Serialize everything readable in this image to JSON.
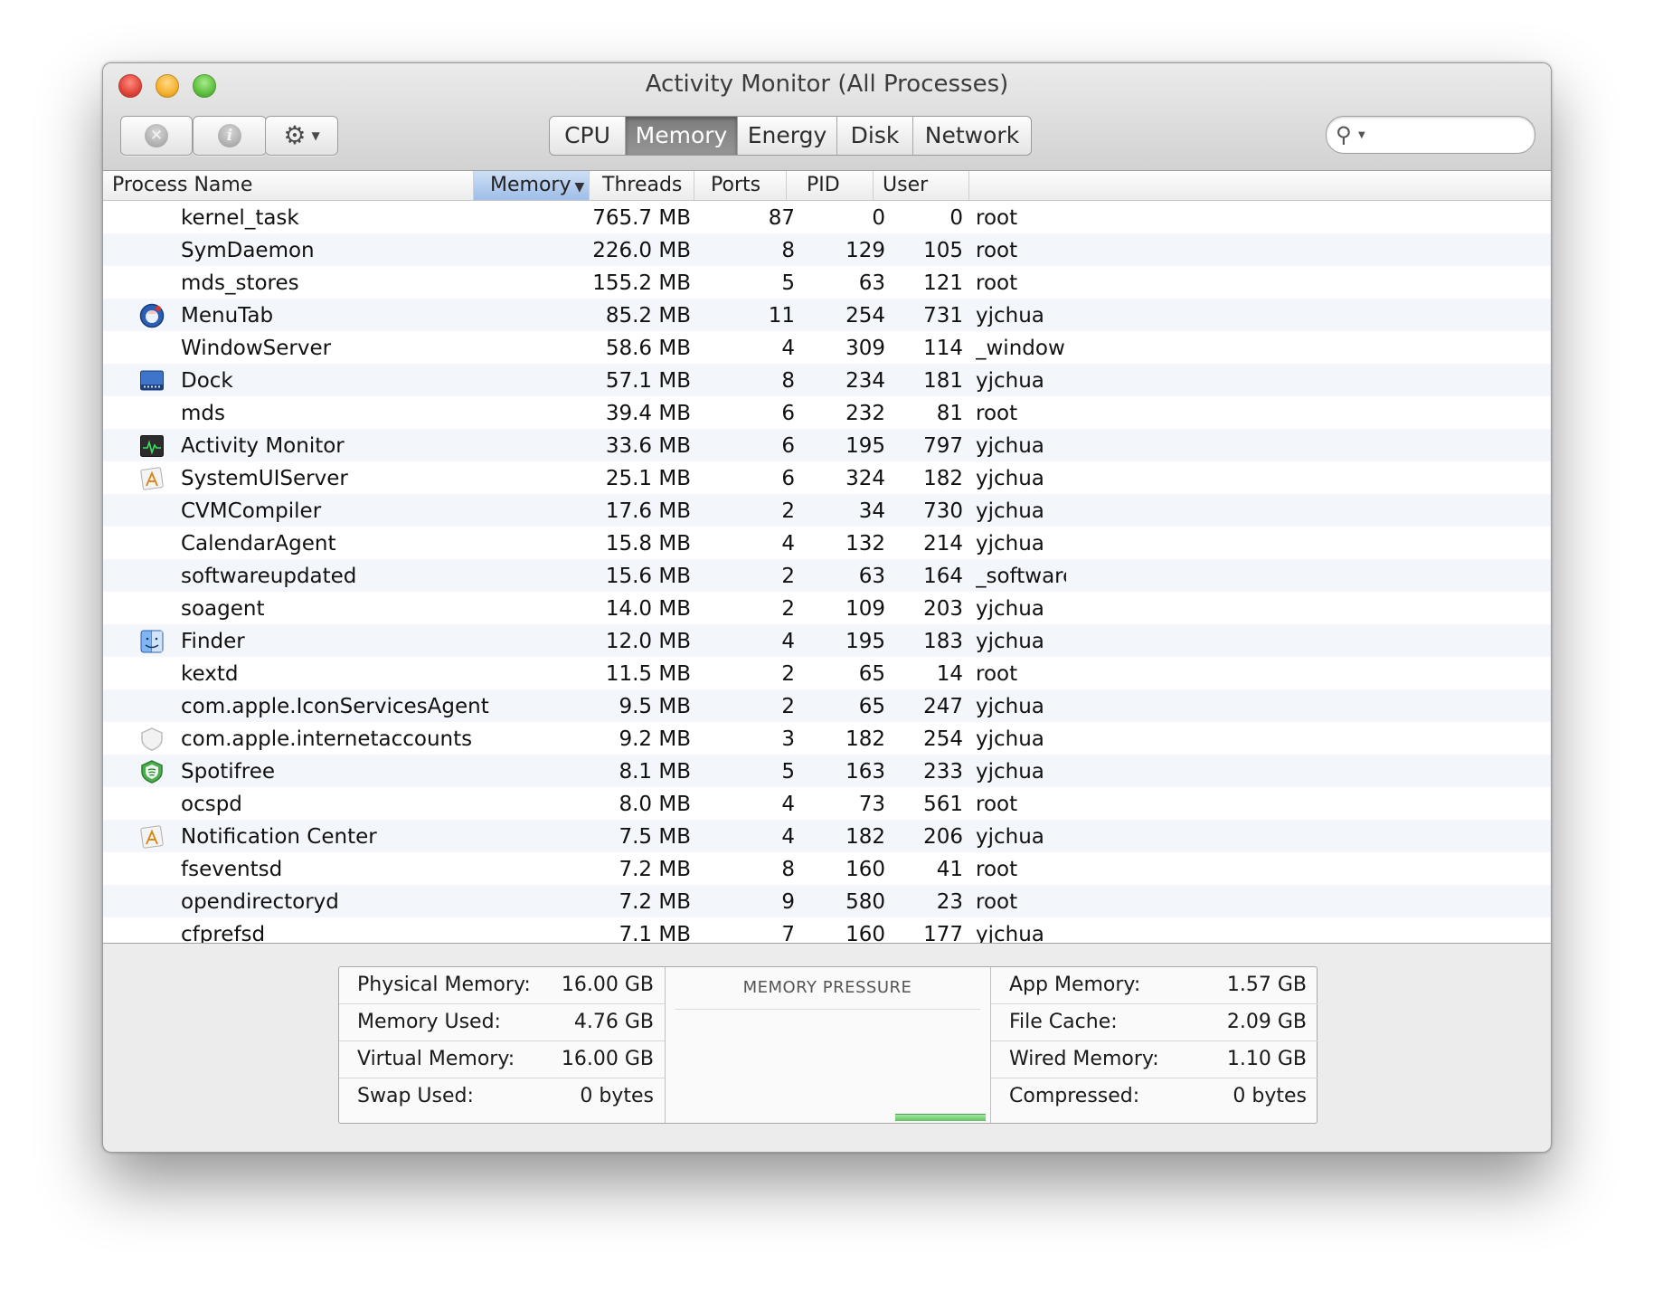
{
  "window": {
    "title": "Activity Monitor (All Processes)"
  },
  "toolbar": {
    "stop_icon": "x-circle-icon",
    "info_icon": "info-circle-icon",
    "gear_icon": "gear-icon",
    "tabs": [
      {
        "label": "CPU",
        "active": false
      },
      {
        "label": "Memory",
        "active": true
      },
      {
        "label": "Energy",
        "active": false
      },
      {
        "label": "Disk",
        "active": false
      },
      {
        "label": "Network",
        "active": false
      }
    ],
    "search": {
      "value": "",
      "placeholder": ""
    }
  },
  "table": {
    "columns": {
      "name": "Process Name",
      "memory": "Memory",
      "threads": "Threads",
      "ports": "Ports",
      "pid": "PID",
      "user": "User"
    },
    "sorted_column": "memory",
    "sort_direction": "descending",
    "rows": [
      {
        "icon": "",
        "name": "kernel_task",
        "memory": "765.7 MB",
        "threads": "87",
        "ports": "0",
        "pid": "0",
        "user": "root"
      },
      {
        "icon": "",
        "name": "SymDaemon",
        "memory": "226.0 MB",
        "threads": "8",
        "ports": "129",
        "pid": "105",
        "user": "root"
      },
      {
        "icon": "",
        "name": "mds_stores",
        "memory": "155.2 MB",
        "threads": "5",
        "ports": "63",
        "pid": "121",
        "user": "root"
      },
      {
        "icon": "menutab",
        "name": "MenuTab",
        "memory": "85.2 MB",
        "threads": "11",
        "ports": "254",
        "pid": "731",
        "user": "yjchua"
      },
      {
        "icon": "",
        "name": "WindowServer",
        "memory": "58.6 MB",
        "threads": "4",
        "ports": "309",
        "pid": "114",
        "user": "_window"
      },
      {
        "icon": "dock",
        "name": "Dock",
        "memory": "57.1 MB",
        "threads": "8",
        "ports": "234",
        "pid": "181",
        "user": "yjchua"
      },
      {
        "icon": "",
        "name": "mds",
        "memory": "39.4 MB",
        "threads": "6",
        "ports": "232",
        "pid": "81",
        "user": "root"
      },
      {
        "icon": "activity-monitor",
        "name": "Activity Monitor",
        "memory": "33.6 MB",
        "threads": "6",
        "ports": "195",
        "pid": "797",
        "user": "yjchua"
      },
      {
        "icon": "generic-app",
        "name": "SystemUIServer",
        "memory": "25.1 MB",
        "threads": "6",
        "ports": "324",
        "pid": "182",
        "user": "yjchua"
      },
      {
        "icon": "",
        "name": "CVMCompiler",
        "memory": "17.6 MB",
        "threads": "2",
        "ports": "34",
        "pid": "730",
        "user": "yjchua"
      },
      {
        "icon": "",
        "name": "CalendarAgent",
        "memory": "15.8 MB",
        "threads": "4",
        "ports": "132",
        "pid": "214",
        "user": "yjchua"
      },
      {
        "icon": "",
        "name": "softwareupdated",
        "memory": "15.6 MB",
        "threads": "2",
        "ports": "63",
        "pid": "164",
        "user": "_software"
      },
      {
        "icon": "",
        "name": "soagent",
        "memory": "14.0 MB",
        "threads": "2",
        "ports": "109",
        "pid": "203",
        "user": "yjchua"
      },
      {
        "icon": "finder",
        "name": "Finder",
        "memory": "12.0 MB",
        "threads": "4",
        "ports": "195",
        "pid": "183",
        "user": "yjchua"
      },
      {
        "icon": "",
        "name": "kextd",
        "memory": "11.5 MB",
        "threads": "2",
        "ports": "65",
        "pid": "14",
        "user": "root"
      },
      {
        "icon": "",
        "name": "com.apple.IconServicesAgent",
        "memory": "9.5 MB",
        "threads": "2",
        "ports": "65",
        "pid": "247",
        "user": "yjchua"
      },
      {
        "icon": "shield-grey",
        "name": "com.apple.internetaccounts",
        "memory": "9.2 MB",
        "threads": "3",
        "ports": "182",
        "pid": "254",
        "user": "yjchua"
      },
      {
        "icon": "shield-green",
        "name": "Spotifree",
        "memory": "8.1 MB",
        "threads": "5",
        "ports": "163",
        "pid": "233",
        "user": "yjchua"
      },
      {
        "icon": "",
        "name": "ocspd",
        "memory": "8.0 MB",
        "threads": "4",
        "ports": "73",
        "pid": "561",
        "user": "root"
      },
      {
        "icon": "generic-app",
        "name": "Notification Center",
        "memory": "7.5 MB",
        "threads": "4",
        "ports": "182",
        "pid": "206",
        "user": "yjchua"
      },
      {
        "icon": "",
        "name": "fseventsd",
        "memory": "7.2 MB",
        "threads": "8",
        "ports": "160",
        "pid": "41",
        "user": "root"
      },
      {
        "icon": "",
        "name": "opendirectoryd",
        "memory": "7.2 MB",
        "threads": "9",
        "ports": "580",
        "pid": "23",
        "user": "root"
      },
      {
        "icon": "",
        "name": "cfprefsd",
        "memory": "7.1 MB",
        "threads": "7",
        "ports": "160",
        "pid": "177",
        "user": "yjchua"
      }
    ]
  },
  "summary": {
    "left": [
      {
        "label": "Physical Memory:",
        "value": "16.00 GB"
      },
      {
        "label": "Memory Used:",
        "value": "4.76 GB"
      },
      {
        "label": "Virtual Memory:",
        "value": "16.00 GB"
      },
      {
        "label": "Swap Used:",
        "value": "0 bytes"
      }
    ],
    "pressure_title": "MEMORY PRESSURE",
    "pressure_color": "#62c462",
    "right": [
      {
        "label": "App Memory:",
        "value": "1.57 GB"
      },
      {
        "label": "File Cache:",
        "value": "2.09 GB"
      },
      {
        "label": "Wired Memory:",
        "value": "1.10 GB"
      },
      {
        "label": "Compressed:",
        "value": "0 bytes"
      }
    ]
  }
}
